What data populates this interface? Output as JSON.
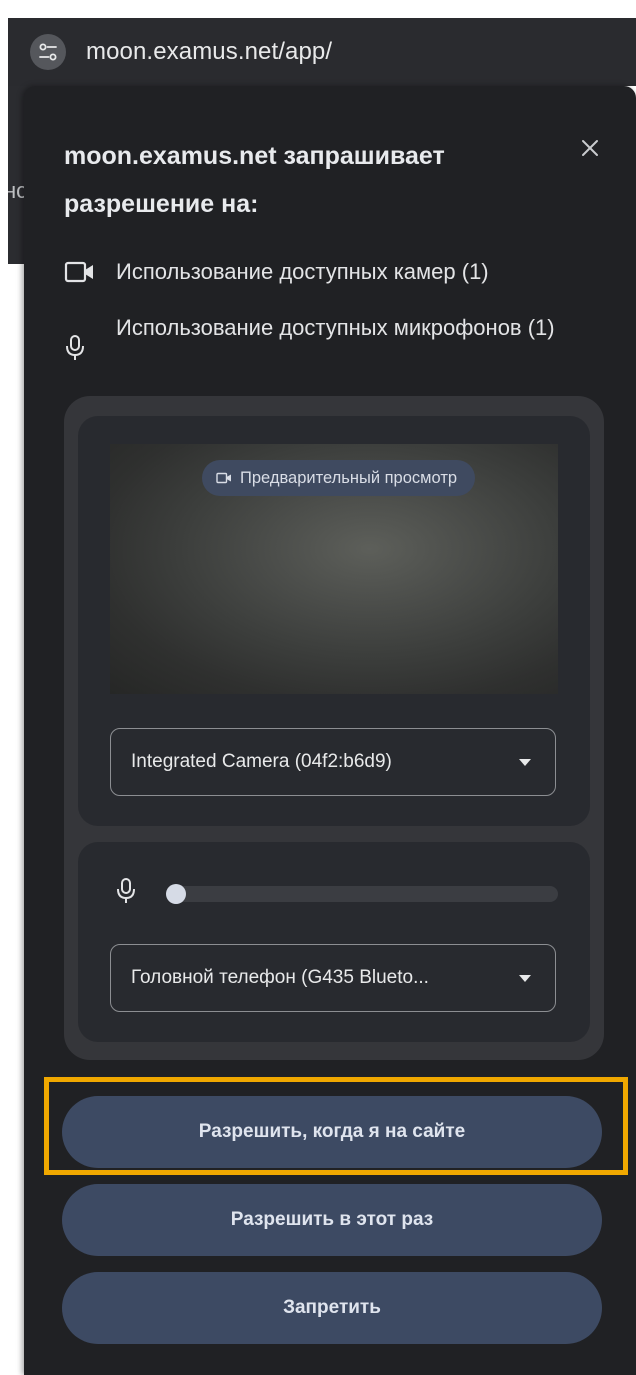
{
  "browser": {
    "url": "moon.examus.net/app/",
    "site_info_icon": "tune-icon",
    "background_page_text": "нс"
  },
  "popup": {
    "title_domain": "moon.examus.net",
    "title_rest": " запрашивает разрешение на:",
    "close_icon": "close-icon",
    "permissions": [
      {
        "icon": "camera-icon",
        "label": "Использование доступных камер (1)"
      },
      {
        "icon": "microphone-icon",
        "label": "Использование доступных микрофонов (1)"
      }
    ],
    "camera": {
      "preview_badge": "Предварительный просмотр",
      "selected_device": "Integrated Camera (04f2:b6d9)"
    },
    "microphone": {
      "level": 0.02,
      "selected_device": "Головной телефон (G435 Blueto..."
    },
    "buttons": {
      "allow_while_visiting": "Разрешить, когда я на сайте",
      "allow_this_time": "Разрешить в этот раз",
      "deny": "Запретить"
    },
    "highlight_color": "#f0a800"
  }
}
